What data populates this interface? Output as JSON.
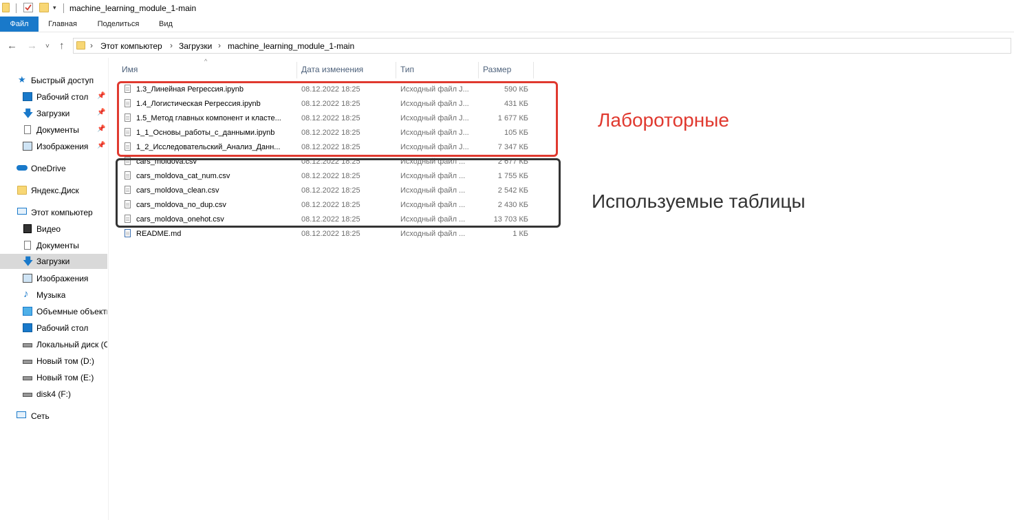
{
  "window": {
    "title": "machine_learning_module_1-main"
  },
  "ribbon": {
    "tabs": [
      "Файл",
      "Главная",
      "Поделиться",
      "Вид"
    ]
  },
  "address": {
    "crumbs": [
      "Этот компьютер",
      "Загрузки",
      "machine_learning_module_1-main"
    ]
  },
  "sidebar": {
    "quick_access": "Быстрый доступ",
    "quick_items": [
      "Рабочий стол",
      "Загрузки",
      "Документы",
      "Изображения"
    ],
    "onedrive": "OneDrive",
    "yandex": "Яндекс.Диск",
    "this_pc": "Этот компьютер",
    "pc_items": [
      "Видео",
      "Документы",
      "Загрузки",
      "Изображения",
      "Музыка",
      "Объемные объекты",
      "Рабочий стол",
      "Локальный диск (C:)",
      "Новый том (D:)",
      "Новый том (E:)",
      "disk4 (F:)"
    ],
    "network": "Сеть",
    "selected": "Загрузки"
  },
  "columns": {
    "name": "Имя",
    "date": "Дата изменения",
    "type": "Тип",
    "size": "Размер"
  },
  "files": [
    {
      "name": "1.3_Линейная Регрессия.ipynb",
      "date": "08.12.2022 18:25",
      "type": "Исходный файл J...",
      "size": "590 КБ"
    },
    {
      "name": "1.4_Логистическая Регрессия.ipynb",
      "date": "08.12.2022 18:25",
      "type": "Исходный файл J...",
      "size": "431 КБ"
    },
    {
      "name": "1.5_Метод главных компонент и класте...",
      "date": "08.12.2022 18:25",
      "type": "Исходный файл J...",
      "size": "1 677 КБ"
    },
    {
      "name": "1_1_Основы_работы_с_данными.ipynb",
      "date": "08.12.2022 18:25",
      "type": "Исходный файл J...",
      "size": "105 КБ"
    },
    {
      "name": "1_2_Исследовательский_Анализ_Данн...",
      "date": "08.12.2022 18:25",
      "type": "Исходный файл J...",
      "size": "7 347 КБ"
    },
    {
      "name": "cars_moldova.csv",
      "date": "08.12.2022 18:25",
      "type": "Исходный файл ...",
      "size": "2 677 КБ"
    },
    {
      "name": "cars_moldova_cat_num.csv",
      "date": "08.12.2022 18:25",
      "type": "Исходный файл ...",
      "size": "1 755 КБ"
    },
    {
      "name": "cars_moldova_clean.csv",
      "date": "08.12.2022 18:25",
      "type": "Исходный файл ...",
      "size": "2 542 КБ"
    },
    {
      "name": "cars_moldova_no_dup.csv",
      "date": "08.12.2022 18:25",
      "type": "Исходный файл ...",
      "size": "2 430 КБ"
    },
    {
      "name": "cars_moldova_onehot.csv",
      "date": "08.12.2022 18:25",
      "type": "Исходный файл ...",
      "size": "13 703 КБ"
    },
    {
      "name": "README.md",
      "date": "08.12.2022 18:25",
      "type": "Исходный файл ...",
      "size": "1 КБ"
    }
  ],
  "annotations": {
    "labs": "Лабороторные",
    "tables": "Используемые таблицы",
    "labs_color": "#e0392f",
    "tables_color": "#333333"
  },
  "colors": {
    "file_tab": "#1979ca",
    "selection": "#d9d9d9"
  }
}
